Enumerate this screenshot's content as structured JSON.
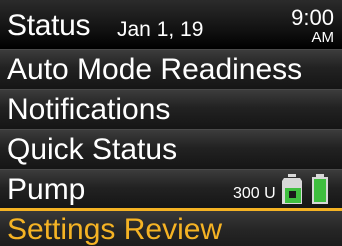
{
  "header": {
    "title": "Status",
    "date": "Jan 1, 19",
    "time": "9:00",
    "ampm": "AM"
  },
  "menu": {
    "items": [
      {
        "label": "Auto Mode Readiness"
      },
      {
        "label": "Notifications"
      },
      {
        "label": "Quick Status"
      },
      {
        "label": "Pump"
      },
      {
        "label": "Settings Review"
      }
    ],
    "selected_index": 4
  },
  "pump": {
    "reservoir": "300 U",
    "reservoir_icon": "reservoir-icon",
    "battery_icon": "battery-icon",
    "battery_level": 1.0
  },
  "colors": {
    "background": "#000000",
    "text": "#ffffff",
    "highlight": "#f5b324",
    "status_green": "#3fbf3f"
  }
}
